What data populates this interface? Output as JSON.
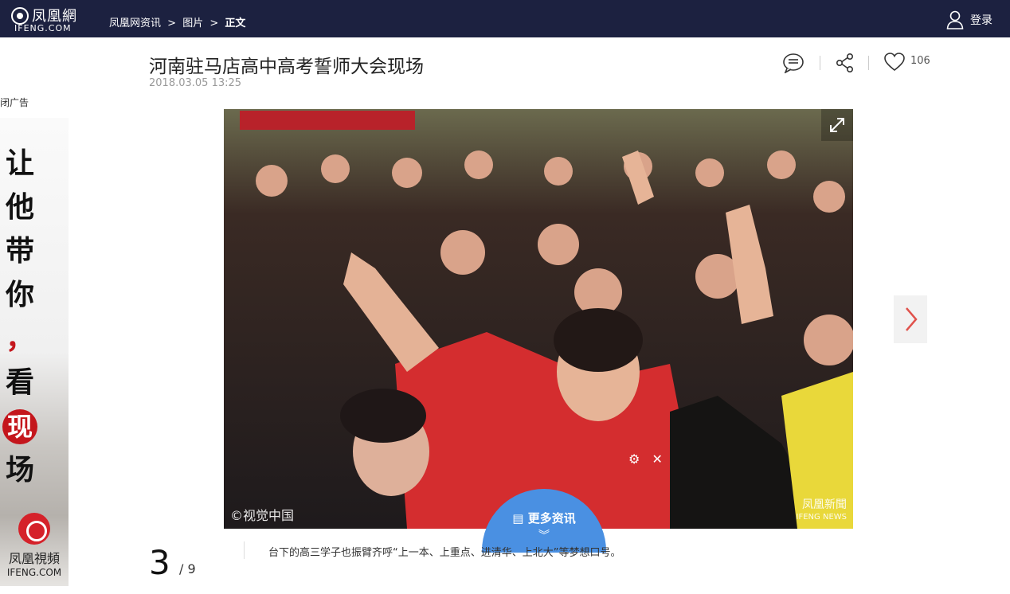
{
  "header": {
    "logo_cn": "凤凰網",
    "logo_en": "IFENG.COM",
    "breadcrumb": [
      "凤凰网资讯",
      ">",
      "图片",
      ">",
      "正文"
    ],
    "login_label": "登录"
  },
  "ad": {
    "close_label": "闭广告",
    "slogan": [
      "让",
      "他",
      "带",
      "你",
      "，",
      "看",
      "现",
      "场"
    ],
    "logo_cn": "凤凰視頻",
    "logo_en": "IFENG.COM"
  },
  "article": {
    "title": "河南驻马店高中高考誓师大会现场",
    "date": "2018.03.05 13:25",
    "like_count": "106"
  },
  "photo": {
    "watermark_left": "©视觉中国",
    "watermark_right_cn": "凤凰新聞",
    "watermark_right_en": "IFENG NEWS"
  },
  "more_news": {
    "label": "更多资讯"
  },
  "pager": {
    "current": "3",
    "total": "/ 9"
  },
  "caption": "台下的高三学子也振臂齐呼“上一本、上重点、进清华、上北大”等梦想口号。",
  "colors": {
    "topbar": "#1c2140",
    "accent_red": "#e0524c",
    "more_blue": "#4a90e2"
  }
}
